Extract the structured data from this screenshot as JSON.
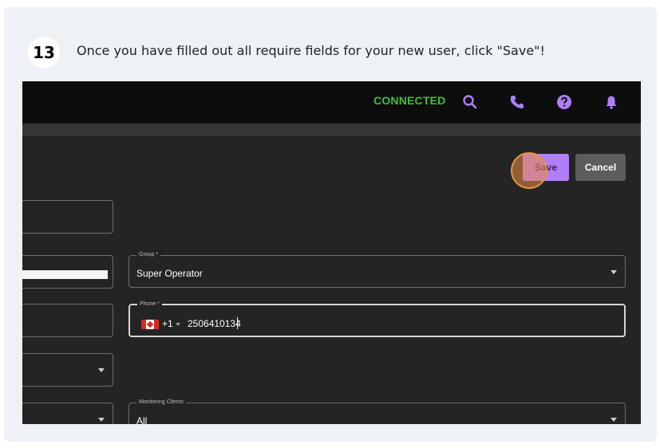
{
  "step": {
    "number": "13",
    "instruction": "Once you have filled out all require fields for your new user, click \"Save\"!"
  },
  "topbar": {
    "status": "CONNECTED",
    "icons": [
      "search-icon",
      "phone-icon",
      "help-icon",
      "bell-icon"
    ],
    "status_color": "#3fbf3f",
    "icon_color": "#b07ef8"
  },
  "actions": {
    "save_label": "Save",
    "cancel_label": "Cancel"
  },
  "form": {
    "group": {
      "label": "Group *",
      "value": "Super Operator"
    },
    "phone": {
      "label": "Phone *",
      "dial_code": "+1",
      "number": "2506410134",
      "flag": "canada-flag-icon"
    },
    "monitoring_clients": {
      "label": "Monitoring Clients",
      "value": "All"
    }
  },
  "colors": {
    "accent": "#b07ef8",
    "background": "#242424",
    "topbar": "#0d0d0d",
    "click_marker": "#e8913f"
  }
}
